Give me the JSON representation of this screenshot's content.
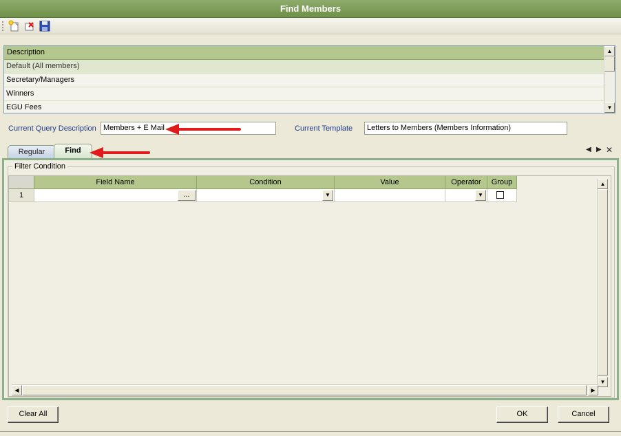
{
  "window": {
    "title": "Find Members"
  },
  "toolbar": {
    "icons": [
      "new-icon",
      "delete-icon",
      "save-icon"
    ]
  },
  "query_list": {
    "header": "Description",
    "rows": [
      "Default (All members)",
      "Secretary/Managers",
      "Winners",
      "EGU Fees"
    ],
    "selected_index": 0
  },
  "query": {
    "description_label": "Current Query Description",
    "description_value": "Members + E Mail",
    "template_label": "Current Template",
    "template_value": "Letters to Members   (Members Information)"
  },
  "tabs": {
    "items": [
      "Regular",
      "Find"
    ],
    "active": "Find",
    "controls": {
      "prev": "◀",
      "next": "▶",
      "close": "✕"
    }
  },
  "filter": {
    "group_title": "Filter Condition",
    "columns": [
      "Field Name",
      "Condition",
      "Value",
      "Operator",
      "Group"
    ],
    "rows": [
      {
        "number": "1",
        "field_name": "",
        "condition": "",
        "value": "",
        "operator": "",
        "group": false
      }
    ],
    "ellipsis": "..."
  },
  "buttons": {
    "clear_all": "Clear All",
    "ok": "OK",
    "cancel": "Cancel"
  },
  "colors": {
    "title_bar": "#7a9a55",
    "header_green": "#b4c88e",
    "label_blue": "#1f3a8a",
    "arrow_red": "#e11b1b"
  }
}
